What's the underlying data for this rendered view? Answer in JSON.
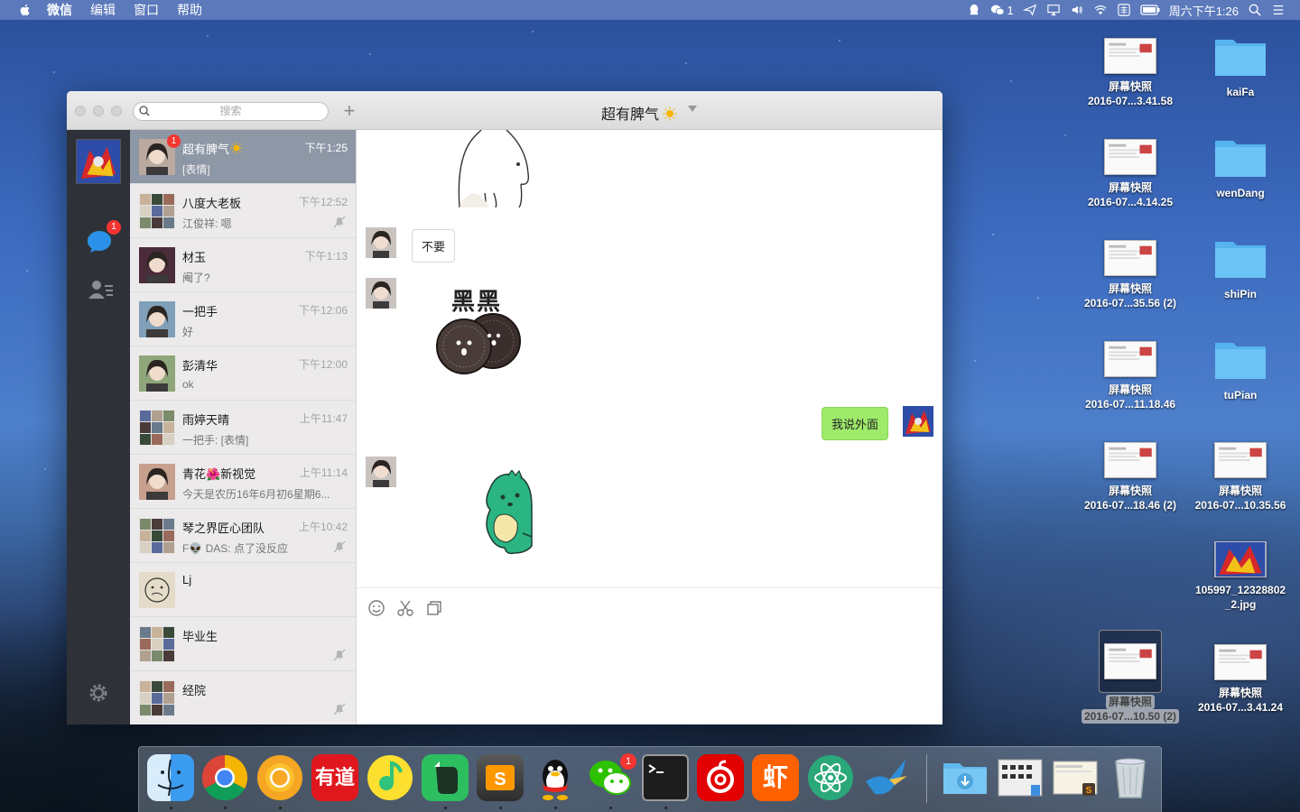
{
  "menubar": {
    "items": [
      "微信",
      "编辑",
      "窗口",
      "帮助"
    ],
    "wechat_count": "1",
    "clock": "周六下午1:26"
  },
  "window": {
    "search_placeholder": "搜索",
    "chat_title": "超有脾气",
    "nav_badge": "1"
  },
  "conversations": [
    {
      "name": "超有脾气",
      "time": "下午1:25",
      "preview": "[表情]",
      "badge": "1",
      "muted": false,
      "active": true
    },
    {
      "name": "八度大老板",
      "time": "下午12:52",
      "preview": "江俊祥: 嗯",
      "muted": true
    },
    {
      "name": "材玉",
      "time": "下午1:13",
      "preview": "阉了?",
      "muted": false
    },
    {
      "name": "一把手",
      "time": "下午12:06",
      "preview": "好",
      "muted": false
    },
    {
      "name": "彭清华",
      "time": "下午12:00",
      "preview": "ok",
      "muted": false
    },
    {
      "name": "雨婷天晴",
      "time": "上午11:47",
      "preview": "一把手: [表情]",
      "muted": false
    },
    {
      "name": "青花🌺新视觉",
      "time": "上午11:14",
      "preview": "今天是农历16年6月初6星期6...",
      "muted": false
    },
    {
      "name": "琴之界匠心团队",
      "time": "上午10:42",
      "preview": "F👽 DAS: 点了没反应",
      "muted": true
    },
    {
      "name": "Lj",
      "time": "",
      "preview": "",
      "muted": false
    },
    {
      "name": "毕业生",
      "time": "",
      "preview": "",
      "muted": true
    },
    {
      "name": "经院",
      "time": "",
      "preview": "",
      "muted": true
    }
  ],
  "messages": {
    "msg1": "不要",
    "sticker_text": "黑黑",
    "msg2": "我说外面"
  },
  "desktop": [
    {
      "label1": "屏幕快照",
      "label2": "2016-07...3.41.58"
    },
    {
      "label1": "kaiFa",
      "label2": ""
    },
    {
      "label1": "屏幕快照",
      "label2": "2016-07...4.14.25"
    },
    {
      "label1": "wenDang",
      "label2": ""
    },
    {
      "label1": "屏幕快照",
      "label2": "2016-07...35.56 (2)"
    },
    {
      "label1": "shiPin",
      "label2": ""
    },
    {
      "label1": "屏幕快照",
      "label2": "2016-07...11.18.46"
    },
    {
      "label1": "tuPian",
      "label2": ""
    },
    {
      "label1": "屏幕快照",
      "label2": "2016-07...18.46 (2)"
    },
    {
      "label1": "屏幕快照",
      "label2": "2016-07...10.35.56"
    },
    {
      "label1": "105997_12328802",
      "label2": "_2.jpg"
    },
    {
      "label1": "屏幕快照",
      "label2": "2016-07...10.50 (2)"
    },
    {
      "label1": "屏幕快照",
      "label2": "2016-07...3.41.24"
    }
  ],
  "dock": {
    "apps": [
      "finder-icon",
      "chrome-icon",
      "chrome-canary-icon",
      "youdao-icon",
      "qq-music-icon",
      "evernote-icon",
      "sublime-text-icon",
      "qq-icon",
      "wechat-icon",
      "terminal-icon",
      "netease-music-icon",
      "xiami-icon",
      "atom-icon",
      "hummingbird-icon"
    ],
    "wechat_badge": "1",
    "youdao_label": "有道",
    "xiami_label": "虾"
  },
  "colors": {
    "accent_badge": "#f43530",
    "sent_bubble": "#9eea6a",
    "nav_bg": "#2e3238",
    "active_row": "#8e97a6"
  }
}
